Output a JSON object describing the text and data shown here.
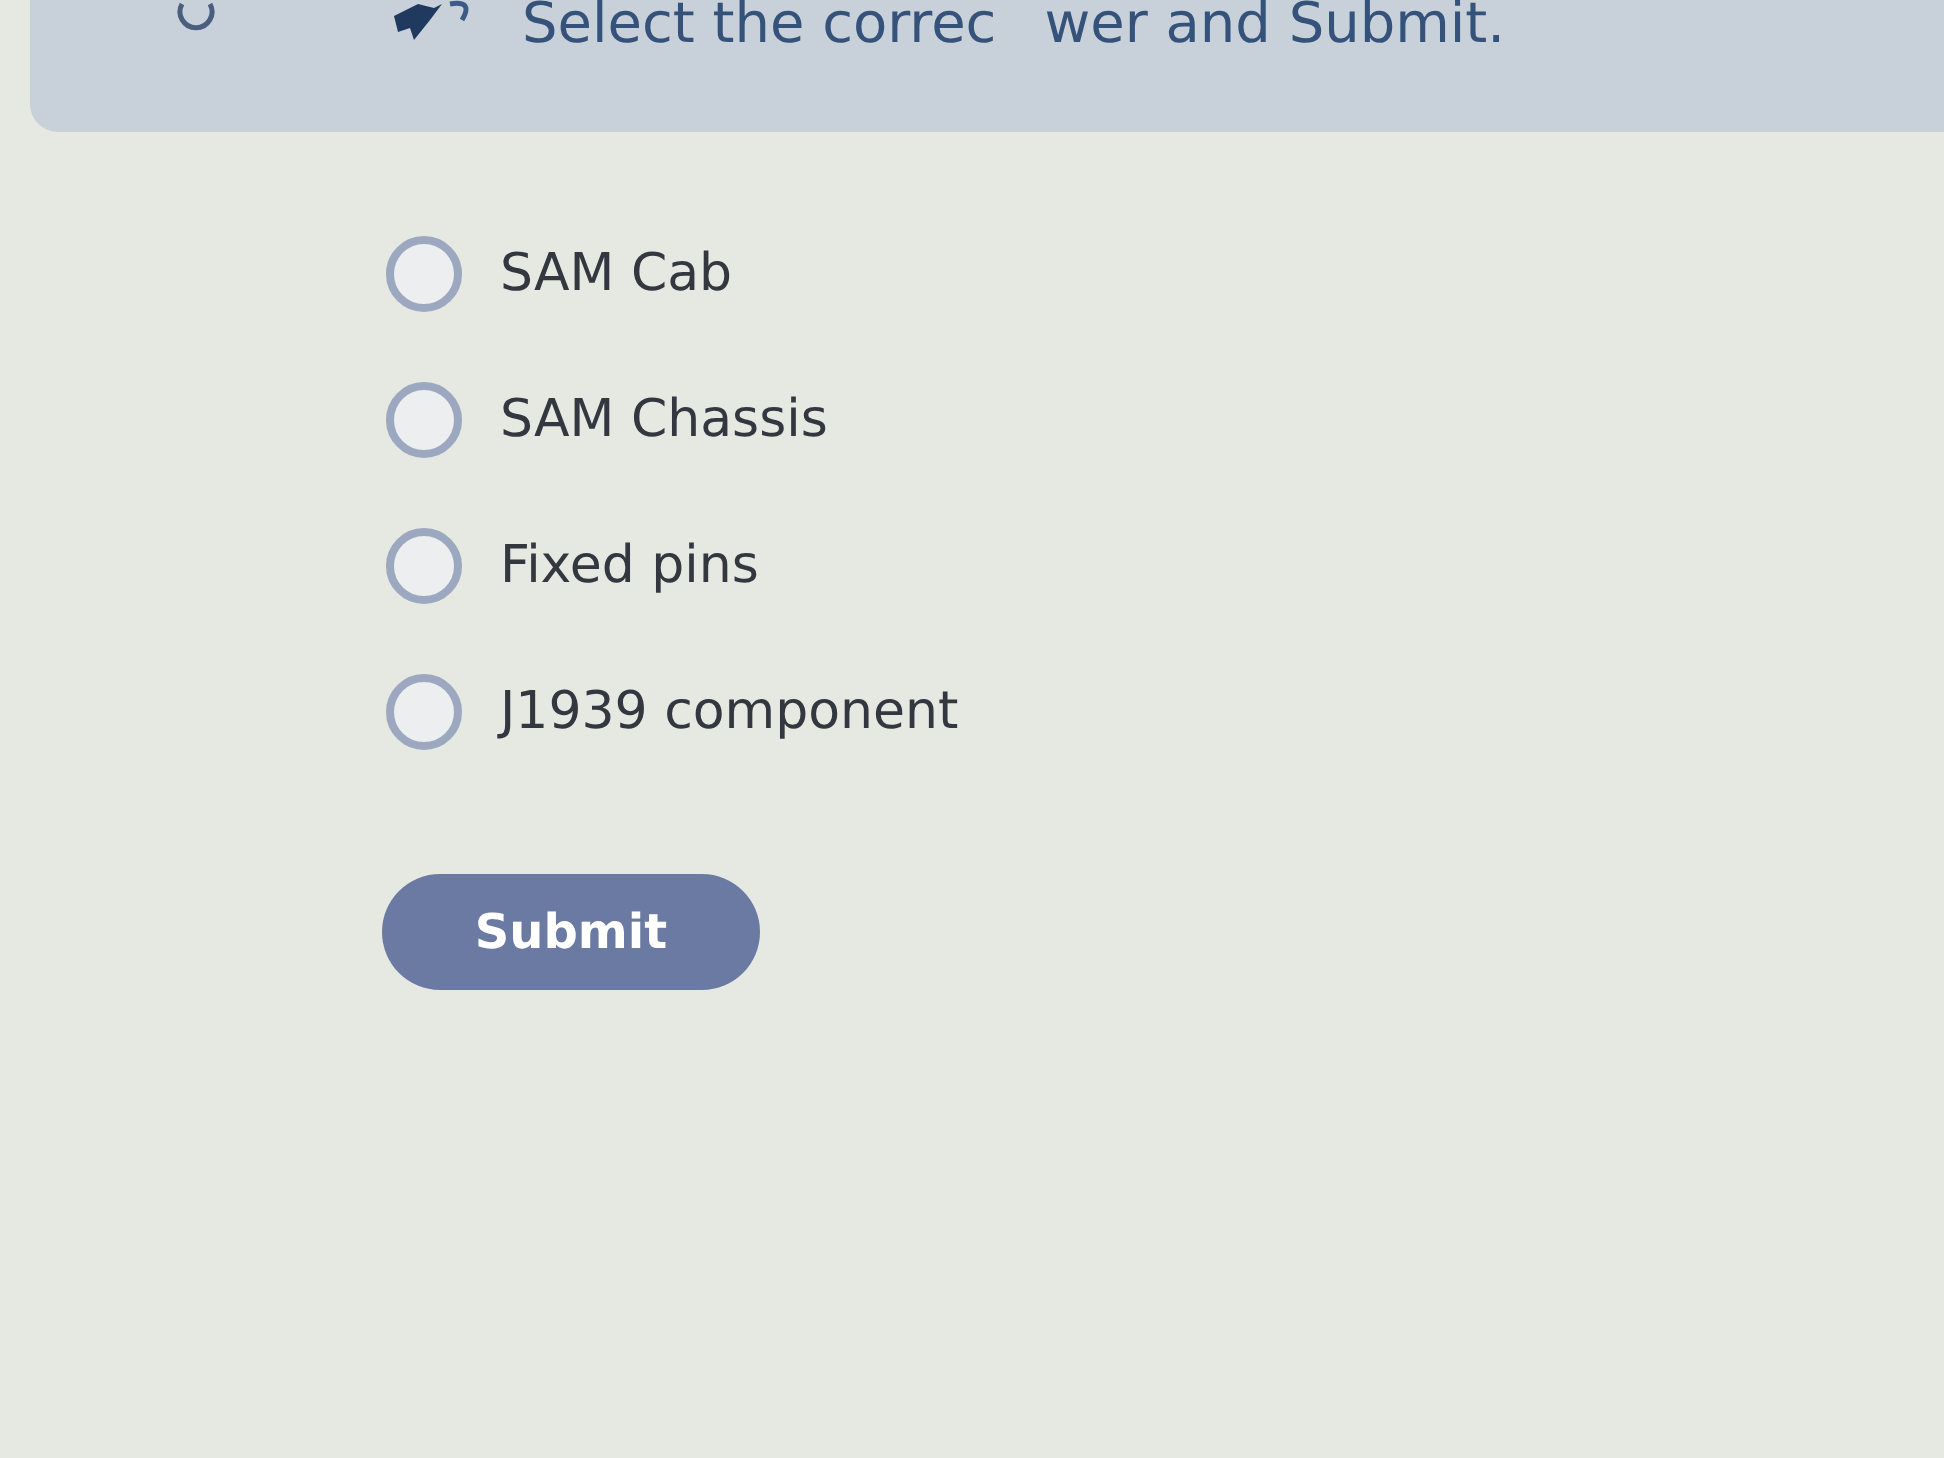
{
  "header": {
    "instruction_parts": [
      "Select the correc",
      "wer and Submit."
    ]
  },
  "options": [
    {
      "label": "SAM Cab",
      "selected": false
    },
    {
      "label": "SAM Chassis",
      "selected": false
    },
    {
      "label": "Fixed pins",
      "selected": false
    },
    {
      "label": "J1939 component",
      "selected": false
    }
  ],
  "submit_button": {
    "label": "Submit"
  }
}
